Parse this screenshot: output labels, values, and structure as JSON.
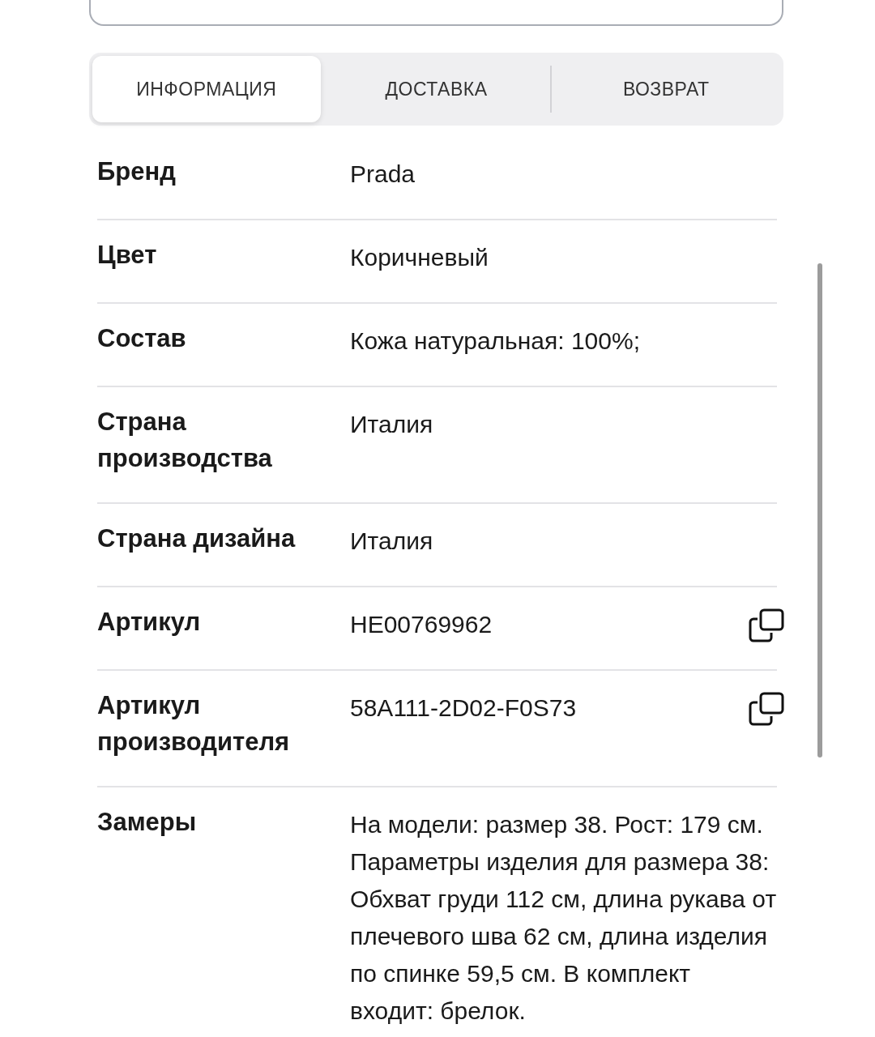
{
  "tabs": [
    {
      "label": "ИНФОРМАЦИЯ",
      "selected": true
    },
    {
      "label": "ДОСТАВКА",
      "selected": false
    },
    {
      "label": "ВОЗВРАТ",
      "selected": false
    }
  ],
  "details": [
    {
      "label": "Бренд",
      "value": "Prada",
      "copyable": false
    },
    {
      "label": "Цвет",
      "value": "Коричневый",
      "copyable": false
    },
    {
      "label": "Состав",
      "value": "Кожа натуральная: 100%;",
      "copyable": false
    },
    {
      "label": "Страна производства",
      "value": "Италия",
      "copyable": false
    },
    {
      "label": "Страна дизайна",
      "value": "Италия",
      "copyable": false
    },
    {
      "label": "Артикул",
      "value": "HE00769962",
      "copyable": true
    },
    {
      "label": "Артикул производителя",
      "value": "58A111-2D02-F0S73",
      "copyable": true
    },
    {
      "label": "Замеры",
      "value": "На модели: размер 38. Рост: 179 см. Параметры изделия для размера 38: Обхват груди 112 см, длина рукава от плечевого шва 62 см, длина изделия по спинке 59,5 см. В комплект входит: брелок.",
      "copyable": false
    }
  ]
}
